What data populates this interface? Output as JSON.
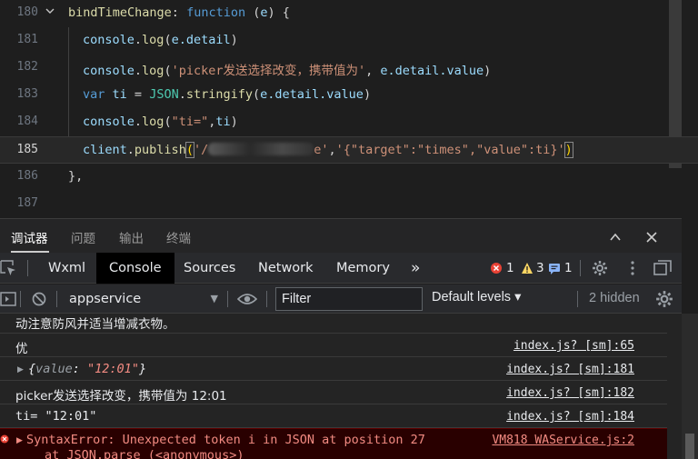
{
  "editor": {
    "lines": [
      {
        "num": "180",
        "kind": "fn_def",
        "name": "bindTimeChange",
        "keyword": "function",
        "param": "e"
      },
      {
        "num": "181",
        "kind": "log",
        "obj": "console",
        "method": "log",
        "arg": "e.detail"
      },
      {
        "num": "182",
        "kind": "log_str",
        "obj": "console",
        "method": "log",
        "str": "'picker发送选择改变，携带值为'",
        "arg": "e.detail.value"
      },
      {
        "num": "183",
        "kind": "var",
        "keyword": "var",
        "name": "ti",
        "json": "JSON",
        "method": "stringify",
        "arg": "e.detail.value"
      },
      {
        "num": "184",
        "kind": "log_str2",
        "obj": "console",
        "method": "log",
        "str": "\"ti=\"",
        "arg": "ti"
      },
      {
        "num": "185",
        "kind": "publish",
        "obj": "client",
        "method": "publish",
        "str_prefix": "'/",
        "str_suffix": "e'",
        "payload": "'{\"target\":\"times\",\"value\":ti}'"
      },
      {
        "num": "186",
        "kind": "close",
        "text": "},"
      },
      {
        "num": "187",
        "kind": "empty",
        "text": ""
      }
    ]
  },
  "panel": {
    "tabs": [
      "调试器",
      "问题",
      "输出",
      "终端"
    ],
    "active_tab": "调试器",
    "collapse_icon": "chevron-up-icon",
    "close_icon": "close-icon"
  },
  "devtools": {
    "tabs": [
      "Wxml",
      "Console",
      "Sources",
      "Network",
      "Memory"
    ],
    "active_tab": "Console",
    "more_tabs": "»",
    "errors": "1",
    "warnings": "3",
    "info": "1"
  },
  "console_toolbar": {
    "context": "appservice",
    "filter_placeholder": "Filter",
    "levels": "Default levels ▾",
    "hidden": "2 hidden"
  },
  "messages": [
    {
      "text": "动注意防风并适当增减衣物。",
      "src": ""
    },
    {
      "text": "优",
      "src": "index.js? [sm]:65"
    },
    {
      "text_obj_key": "value",
      "text_obj_val": "\"12:01\"",
      "src": "index.js? [sm]:181"
    },
    {
      "text": "picker发送选择改变，携带值为 12:01",
      "src": "index.js? [sm]:182"
    },
    {
      "text": "ti= \"12:01\"",
      "src": "index.js? [sm]:184"
    },
    {
      "text": "SyntaxError: Unexpected token i in JSON at position 27",
      "text2": "at JSON.parse (<anonymous>)",
      "src": "VM818 WAService.js:2"
    }
  ],
  "colors": {
    "error": "#f28b82",
    "warning": "#fdd663",
    "info": "#8ab4f8",
    "keyword": "#569cd6",
    "string": "#ce9178"
  }
}
